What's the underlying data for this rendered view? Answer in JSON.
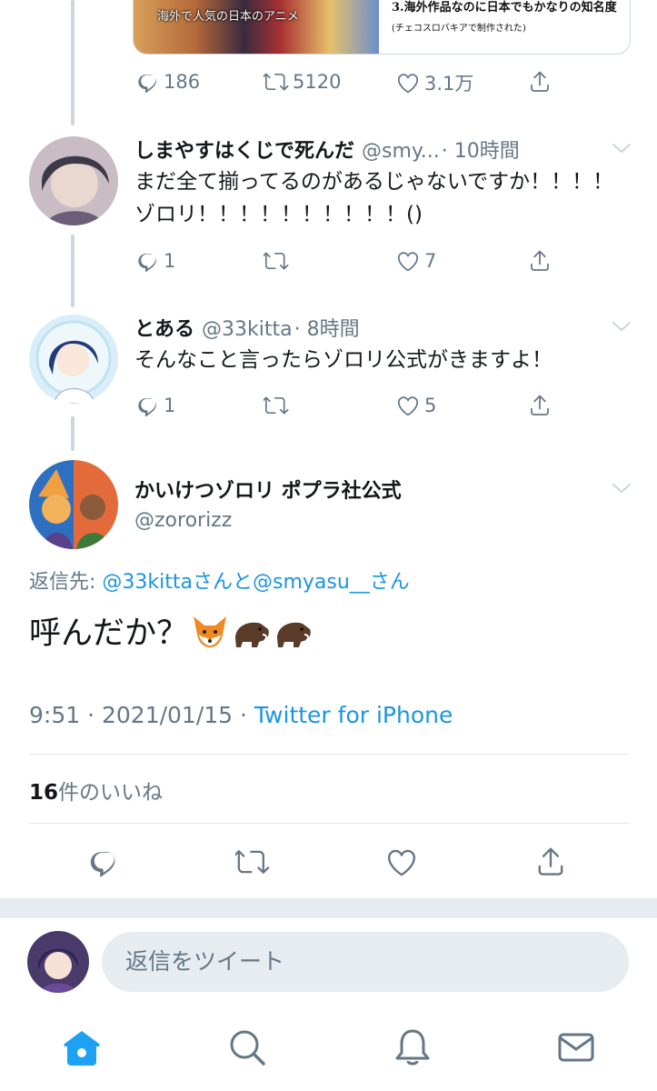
{
  "media_card": {
    "image_caption": "海外で人気の日本のアニメ",
    "line1": "3.海外作品なのに日本でもかなりの知名度",
    "line2": "(チェコスロバキアで制作された)"
  },
  "tweet0": {
    "replies": "186",
    "retweets": "5120",
    "likes": "3.1万"
  },
  "tweet1": {
    "name": "しまやすはくじで死んだ",
    "handle": "@smy...",
    "time": "· 10時間",
    "text": "まだ全て揃ってるのがあるじゃないですか！！！！ゾロリ！！！！！！！！！！()",
    "replies": "1",
    "retweets": "",
    "likes": "7"
  },
  "tweet2": {
    "name": "とある",
    "handle": "@33kitta",
    "time": "· 8時間",
    "text": "そんなこと言ったらゾロリ公式がきますよ！",
    "replies": "1",
    "retweets": "",
    "likes": "5"
  },
  "main": {
    "name": "かいけつゾロリ ポプラ社公式",
    "handle": "@zororizz",
    "reply_prefix": "返信先: ",
    "reply_mention1": "@33kittaさんと",
    "reply_mention2": "@smyasu__さん",
    "text": "呼んだか？",
    "time_date": "9:51 · 2021/01/15 · ",
    "source": "Twitter for iPhone",
    "likes_count": "16",
    "likes_label": "件のいいね"
  },
  "composer": {
    "placeholder": "返信をツイート"
  },
  "icons": [
    "reply-icon",
    "retweet-icon",
    "like-icon",
    "share-icon",
    "chevron-down-icon",
    "home-icon",
    "search-icon",
    "notifications-icon",
    "messages-icon"
  ],
  "colors": {
    "accent": "#1da1f2",
    "link": "#1b95e0",
    "secondary_text": "#657786",
    "divider": "#e1e8ed"
  }
}
